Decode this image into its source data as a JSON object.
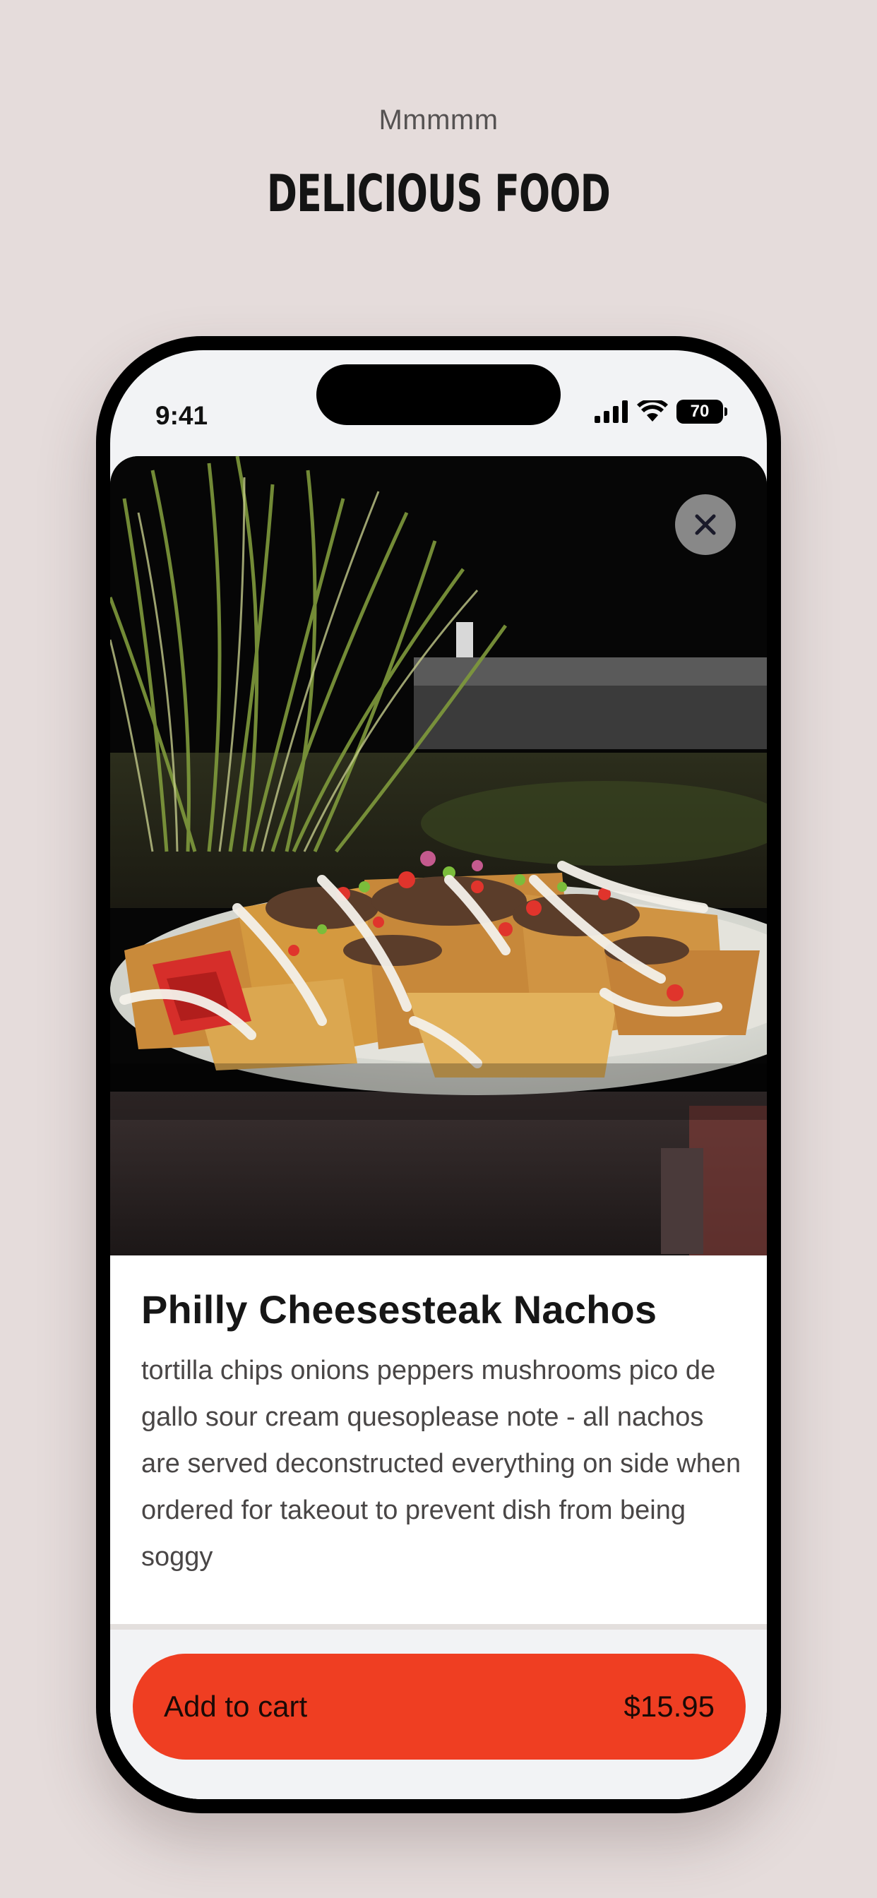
{
  "header": {
    "kicker": "Mmmmm",
    "headline": "Delicious food"
  },
  "status_bar": {
    "time": "9:41",
    "battery": "70",
    "icons": [
      "cellular-signal-icon",
      "wifi-icon",
      "battery-icon"
    ]
  },
  "item": {
    "photo_icon": "food-photo",
    "close_icon": "close-icon",
    "title": "Philly Cheesesteak Nachos",
    "description": "tortilla chips onions peppers mushrooms pico de gallo sour cream quesoplease note - all nachos are served deconstructed everything on side when ordered for takeout to prevent dish from being soggy"
  },
  "cart": {
    "add_label": "Add to cart",
    "price": "$15.95"
  },
  "colors": {
    "background": "#e5dcdb",
    "accent": "#ef3e22",
    "text": "#161616"
  }
}
